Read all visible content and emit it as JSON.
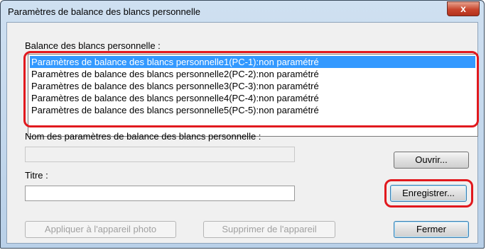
{
  "window": {
    "title": "Paramètres de balance des blancs personnelle",
    "close_glyph": "x"
  },
  "list": {
    "label": "Balance des blancs personnelle :",
    "items": [
      "Paramètres de balance des blancs personnelle1(PC-1):non paramétré",
      "Paramètres de balance des blancs personnelle2(PC-2):non paramétré",
      "Paramètres de balance des blancs personnelle3(PC-3):non paramétré",
      "Paramètres de balance des blancs personnelle4(PC-4):non paramétré",
      "Paramètres de balance des blancs personnelle5(PC-5):non paramétré"
    ],
    "selected_index": 0
  },
  "settings_name": {
    "label": "Nom des paramètres de balance des blancs personnelle :",
    "value": ""
  },
  "title_field": {
    "label": "Titre :",
    "value": ""
  },
  "buttons": {
    "open": "Ouvrir...",
    "save": "Enregistrer...",
    "apply": "Appliquer à l'appareil photo",
    "delete": "Supprimer de l'appareil",
    "close": "Fermer"
  },
  "colors": {
    "highlight": "#e1191e",
    "selection": "#3399ff"
  }
}
